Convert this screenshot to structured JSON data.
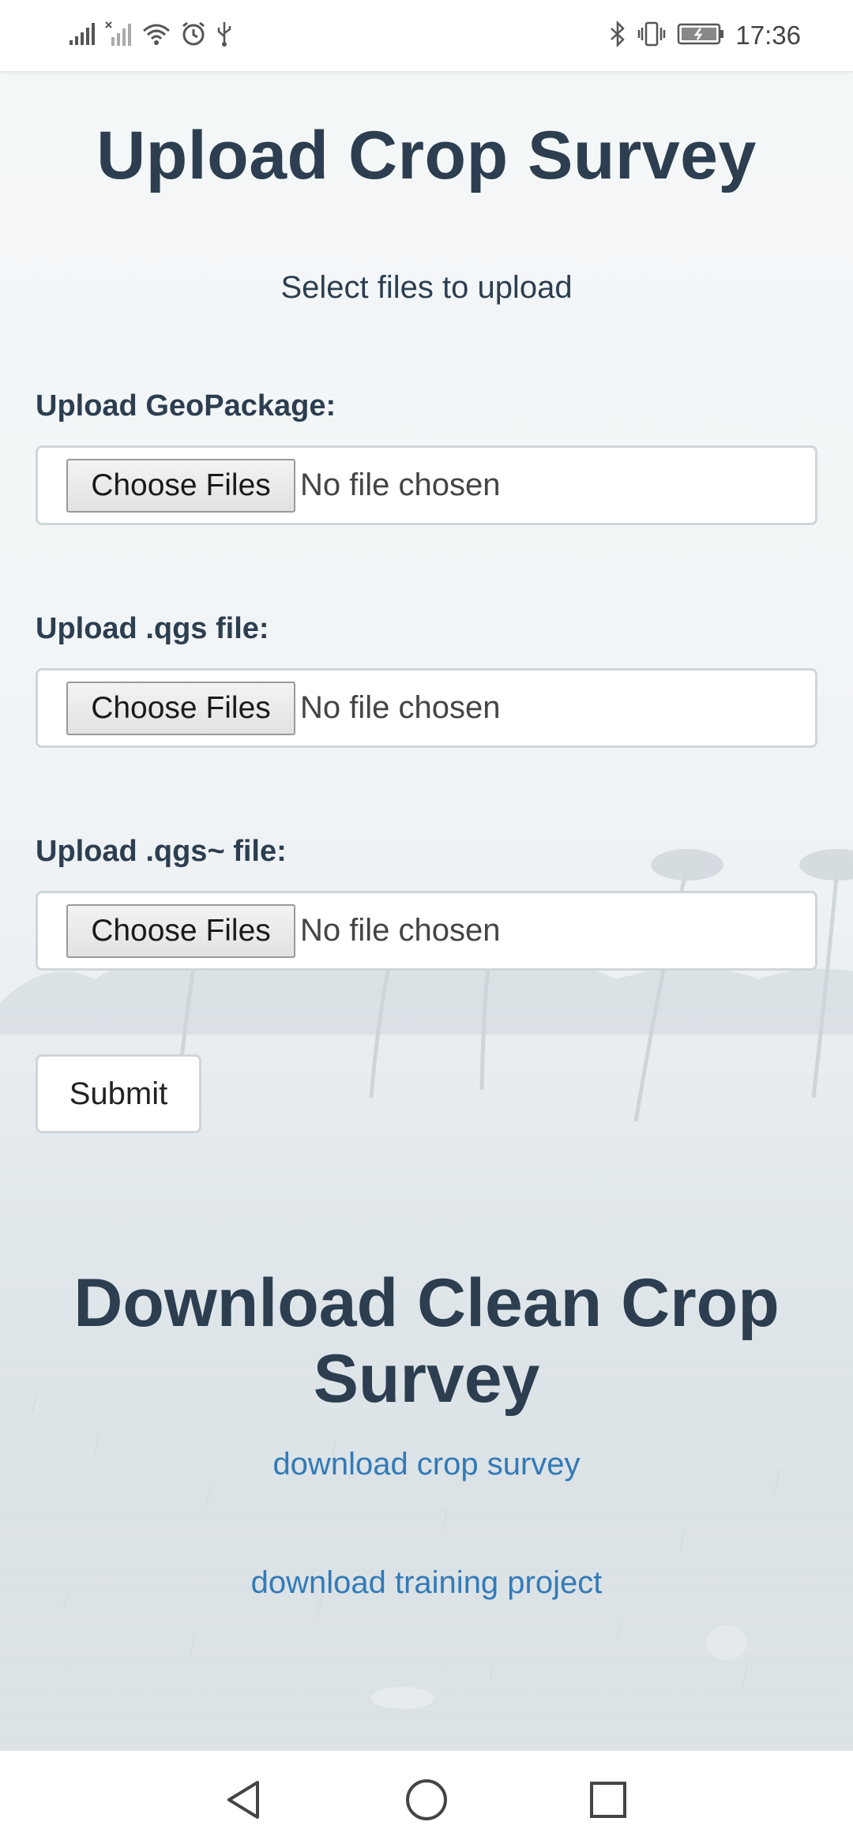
{
  "status_bar": {
    "time": "17:36",
    "left_icons": [
      "signal-icon",
      "no-signal-icon",
      "wifi-icon",
      "alarm-icon",
      "usb-icon"
    ],
    "right_icons": [
      "bluetooth-icon",
      "vibrate-icon",
      "battery-icon"
    ]
  },
  "page": {
    "title": "Upload Crop Survey",
    "subtitle": "Select files to upload"
  },
  "uploads": [
    {
      "label": "Upload GeoPackage:",
      "button": "Choose Files",
      "status": "No file chosen"
    },
    {
      "label": "Upload .qgs file:",
      "button": "Choose Files",
      "status": "No file chosen"
    },
    {
      "label": "Upload .qgs~ file:",
      "button": "Choose Files",
      "status": "No file chosen"
    }
  ],
  "submit_label": "Submit",
  "download": {
    "title": "Download Clean Crop Survey",
    "links": [
      {
        "label": "download crop survey"
      },
      {
        "label": "download training project"
      }
    ]
  },
  "colors": {
    "heading": "#2c3e50",
    "link": "#337ab7",
    "border": "#cfd6da"
  },
  "nav_bar": {
    "icons": [
      "back-icon",
      "home-icon",
      "recents-icon"
    ]
  }
}
